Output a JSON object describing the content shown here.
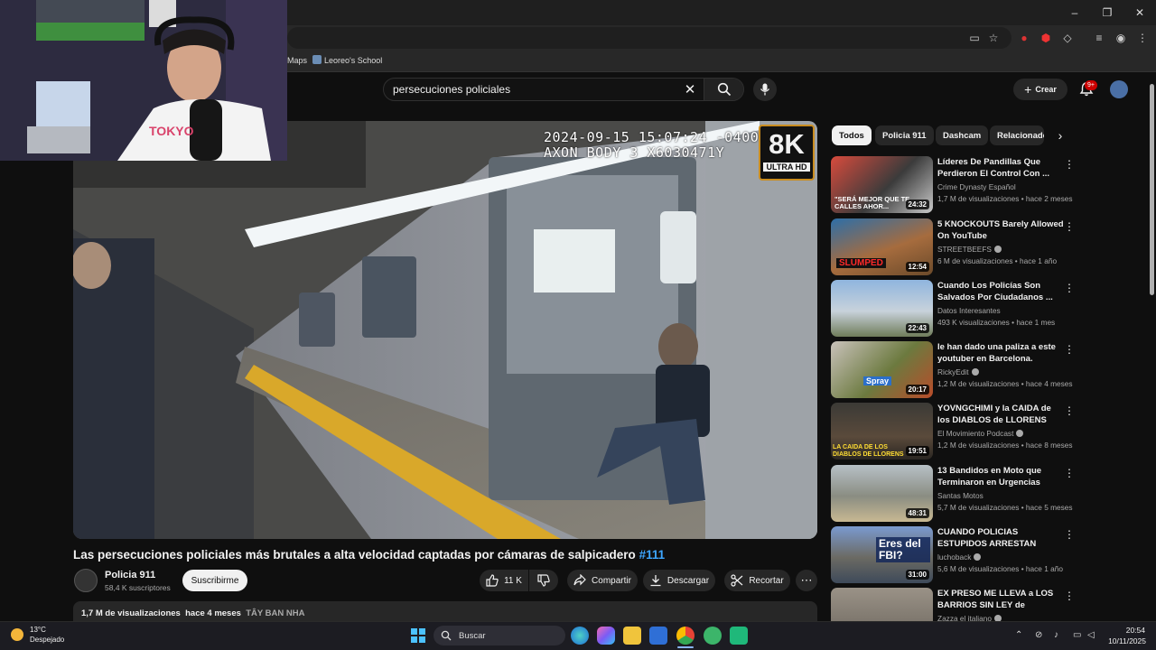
{
  "browser": {
    "bookmarks": [
      {
        "label": "Maps"
      },
      {
        "label": "Leoreo's School"
      }
    ],
    "window_controls": {
      "minimize": "–",
      "maximize": "❐",
      "close": "✕"
    }
  },
  "header": {
    "search_query": "persecuciones policiales",
    "create_label": "Crear",
    "notification_badge": "9+"
  },
  "video": {
    "overlay_timestamp": "2024-09-15 15:07:24 -0400",
    "overlay_device": "AXON BODY 3 X6030471Y",
    "quality_badge_main": "8K",
    "quality_badge_sub": "ULTRA HD",
    "title": "Las persecuciones policiales más brutales a alta velocidad captadas por cámaras de salpicadero",
    "title_tag": "#111",
    "channel_name": "Policia 911",
    "channel_subs": "58,4 K suscriptores",
    "subscribe_label": "Suscribirme",
    "likes": "11 K",
    "share_label": "Compartir",
    "download_label": "Descargar",
    "clip_label": "Recortar",
    "views": "1,7 M de visualizaciones",
    "age": "hace 4 meses",
    "language": "TÂY BAN NHA"
  },
  "chips": [
    "Todos",
    "Policia 911",
    "Dashcam",
    "Relacionado"
  ],
  "related": [
    {
      "title": "Líderes De Pandillas Que Perdieron El Control Con ...",
      "channel": "Crime Dynasty Español",
      "verified": false,
      "views": "1,7 M de visualizaciones",
      "age": "hace 2 meses",
      "duration": "24:32",
      "thumb_text": "\"SERÁ MEJOR QUE TE CALLES AHOR..."
    },
    {
      "title": "5 KNOCKOUTS Barely Allowed On YouTube",
      "channel": "STREETBEEFS",
      "verified": true,
      "views": "6 M de visualizaciones",
      "age": "hace 1 año",
      "duration": "12:54",
      "thumb_text": "SLUMPED"
    },
    {
      "title": "Cuando Los Policías Son Salvados Por Ciudadanos ...",
      "channel": "Datos Interesantes",
      "verified": false,
      "views": "493 K visualizaciones",
      "age": "hace 1 mes",
      "duration": "22:43",
      "thumb_text": ""
    },
    {
      "title": "le han dado una paliza a este youtuber en Barcelona.",
      "channel": "RickyEdit",
      "verified": true,
      "views": "1,2 M de visualizaciones",
      "age": "hace 4 meses",
      "duration": "20:17",
      "thumb_text": "Spray"
    },
    {
      "title": "YOVNGCHIMI y la CAIDA de los DIABLOS de LLORENS",
      "channel": "El Movimiento Podcast",
      "verified": true,
      "views": "1,2 M de visualizaciones",
      "age": "hace 8 meses",
      "duration": "19:51",
      "thumb_text": "LA CAIDA DE LOS DIABLOS DE LLORENS"
    },
    {
      "title": "13 Bandidos en Moto que Terminaron en Urgencias",
      "channel": "Santas Motos",
      "verified": false,
      "views": "5,7 M de visualizaciones",
      "age": "hace 5 meses",
      "duration": "48:31",
      "thumb_text": ""
    },
    {
      "title": "CUANDO POLICIAS ESTUPIDOS ARRESTAN AGENTES DEL FBI",
      "channel": "luchoback",
      "verified": true,
      "views": "5,6 M de visualizaciones",
      "age": "hace 1 año",
      "duration": "31:00",
      "thumb_text": "Eres del FBI?"
    },
    {
      "title": "EX PRESO ME LLEVA a LOS BARRIOS SIN LEY de ROSARI...",
      "channel": "Zazza el italiano",
      "verified": true,
      "views": "",
      "age": "",
      "duration": "",
      "thumb_text": ""
    }
  ],
  "taskbar": {
    "temperature": "13°C",
    "weather": "Despejado",
    "search_label": "Buscar",
    "time": "20:54",
    "date": "10/11/2025"
  },
  "colors": {
    "accent_link": "#3ea6ff",
    "badge_red": "#cc0000",
    "quality_border": "#c98c1f"
  }
}
